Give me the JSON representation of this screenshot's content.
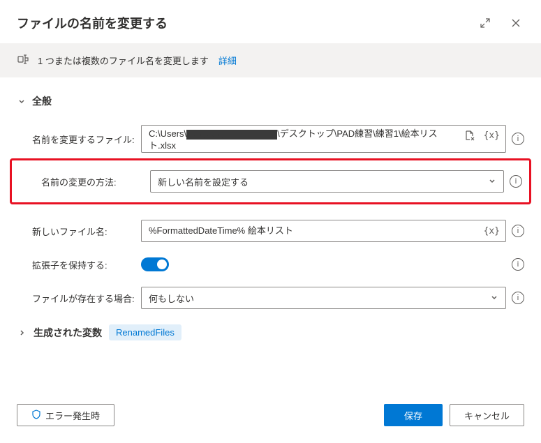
{
  "header": {
    "title": "ファイルの名前を変更する"
  },
  "banner": {
    "text": "1 つまたは複数のファイル名を変更します",
    "link": "詳細"
  },
  "sections": {
    "general": {
      "title": "全般",
      "file_to_rename": {
        "label": "名前を変更するファイル:",
        "value_prefix": "C:\\Users\\",
        "value_suffix": "\\デスクトップ\\PAD練習\\練習1\\絵本リスト.xlsx"
      },
      "rename_scheme": {
        "label": "名前の変更の方法:",
        "value": "新しい名前を設定する"
      },
      "new_filename": {
        "label": "新しいファイル名:",
        "value": "%FormattedDateTime% 絵本リスト"
      },
      "keep_extension": {
        "label": "拡張子を保持する:"
      },
      "if_file_exists": {
        "label": "ファイルが存在する場合:",
        "value": "何もしない"
      }
    },
    "generated_vars": {
      "title": "生成された変数",
      "var_name": "RenamedFiles"
    }
  },
  "footer": {
    "on_error": "エラー発生時",
    "save": "保存",
    "cancel": "キャンセル"
  }
}
